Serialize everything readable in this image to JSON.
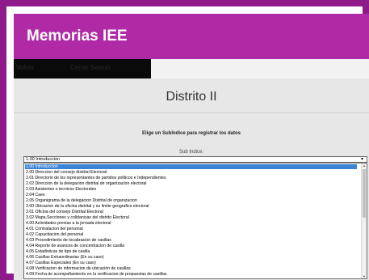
{
  "header": {
    "title": "Memorias IEE"
  },
  "nav": {
    "back_label": "Volver",
    "logout_label": "Cerrar Sesion"
  },
  "main": {
    "district_title": "Distrito II",
    "instruction": "Elige un SubIndice para registrar los datos",
    "subindex_label": "Sub Indice:"
  },
  "select": {
    "selected": "1.00 Introduccion",
    "options": [
      "1.00 Introduccion",
      "2.00 Direccion del consejo distrital Electoral",
      "2.01 Directorio de los representantes de partidos politicos e Independientes",
      "2.02 Direccion de la delegacion distrital de organizacion electoral",
      "2.03 Asistentes o tecnicos Electorales",
      "2.04 Caes",
      "2.05 Organigrama de la delegacion Distrital de organizacion",
      "3.00 Ubicacion de la oficina distrital y su limite geografico electoral",
      "3.01 Oficina del consejo Distrital Electoral",
      "3.02 Mapa,Secciones y colidancias del distrito Electoral",
      "4.00 Actividades previas a la jornada electoral",
      "4.01 Contratacion del personal",
      "4.02 Capacitacion del personal",
      "4.03 Procedimiento de localizacion de casillas",
      "4.04 Reporte de avances de concentracion de casilla",
      "4.05 Estadisticas de tipo de casilla",
      "4.06 Casillas Extraordinarias (En su caso)",
      "4.07 Casillas Especiales (En su caso)",
      "4.08 Verificacion de informacion de ubicación de casillas",
      "4.09 Fecha de acompañamiento en la verificacion de propuestas de casillas"
    ]
  },
  "colors": {
    "frame": "#8f1b8a",
    "header": "#b02aa5",
    "selected": "#3b83d6"
  }
}
